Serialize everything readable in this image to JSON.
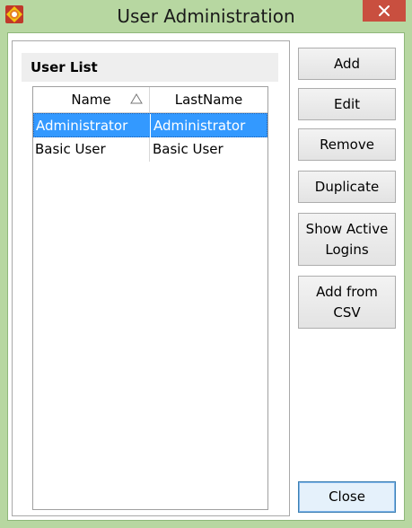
{
  "window": {
    "title": "User Administration",
    "app_icon": "app-logo-icon",
    "close_icon": "close-icon"
  },
  "user_list": {
    "title": "User List",
    "columns": [
      "Name",
      "LastName"
    ],
    "sort_icon": "sort-ascending-icon",
    "rows": [
      [
        "Administrator",
        "Administrator"
      ],
      [
        "Basic User",
        "Basic User"
      ]
    ],
    "selected_row": 0
  },
  "buttons": {
    "add": "Add",
    "edit": "Edit",
    "remove": "Remove",
    "duplicate": "Duplicate",
    "show_active_logins": "Show Active Logins",
    "add_from_csv": "Add from CSV",
    "close": "Close"
  },
  "colors": {
    "frame": "#b7d7a1",
    "close_button": "#c94f3f",
    "selection": "#3399ff"
  }
}
